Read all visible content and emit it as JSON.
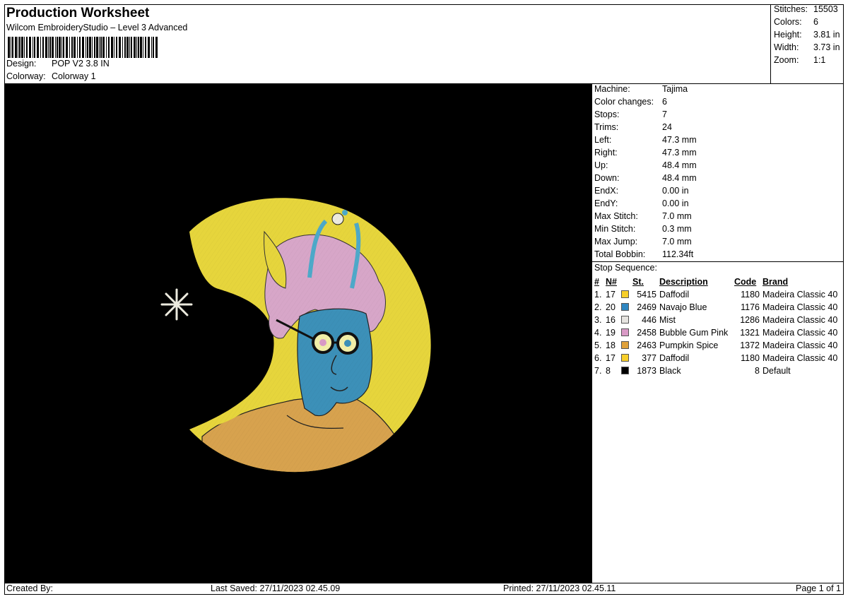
{
  "header": {
    "title": "Production Worksheet",
    "subtitle": "Wilcom EmbroideryStudio – Level 3 Advanced",
    "design_label": "Design:",
    "design_value": "POP V2 3.8 IN",
    "colorway_label": "Colorway:",
    "colorway_value": "Colorway 1"
  },
  "stats": [
    {
      "label": "Stitches:",
      "value": "15503"
    },
    {
      "label": "Colors:",
      "value": "6"
    },
    {
      "label": "Height:",
      "value": "3.81 in"
    },
    {
      "label": "Width:",
      "value": "3.73 in"
    },
    {
      "label": "Zoom:",
      "value": "1:1"
    }
  ],
  "machine": [
    {
      "label": "Machine:",
      "value": "Tajima"
    },
    {
      "label": "Color changes:",
      "value": "6"
    },
    {
      "label": "Stops:",
      "value": "7"
    },
    {
      "label": "Trims:",
      "value": "24"
    },
    {
      "label": "Left:",
      "value": "47.3 mm"
    },
    {
      "label": "Right:",
      "value": "47.3 mm"
    },
    {
      "label": "Up:",
      "value": "48.4 mm"
    },
    {
      "label": "Down:",
      "value": "48.4 mm"
    },
    {
      "label": "EndX:",
      "value": "0.00 in"
    },
    {
      "label": "EndY:",
      "value": "0.00 in"
    },
    {
      "label": "Max Stitch:",
      "value": "7.0 mm"
    },
    {
      "label": "Min Stitch:",
      "value": "0.3 mm"
    },
    {
      "label": "Max Jump:",
      "value": "7.0 mm"
    },
    {
      "label": "Total Bobbin:",
      "value": "112.34ft"
    }
  ],
  "stop_sequence": {
    "title": "Stop Sequence:",
    "headers": {
      "num": "#",
      "n": "N#",
      "st": "St.",
      "description": "Description",
      "code": "Code",
      "brand": "Brand"
    },
    "rows": [
      {
        "num": "1.",
        "n": "17",
        "color": "#F7CF2A",
        "st": "5415",
        "description": "Daffodil",
        "code": "1180",
        "brand": "Madeira Classic 40"
      },
      {
        "num": "2.",
        "n": "20",
        "color": "#2E86C1",
        "st": "2469",
        "description": "Navajo Blue",
        "code": "1176",
        "brand": "Madeira Classic 40"
      },
      {
        "num": "3.",
        "n": "16",
        "color": "#E6E4E0",
        "st": "446",
        "description": "Mist",
        "code": "1286",
        "brand": "Madeira Classic 40"
      },
      {
        "num": "4.",
        "n": "19",
        "color": "#D99AC6",
        "st": "2458",
        "description": "Bubble Gum Pink",
        "code": "1321",
        "brand": "Madeira Classic 40"
      },
      {
        "num": "5.",
        "n": "18",
        "color": "#E0A23C",
        "st": "2463",
        "description": "Pumpkin Spice",
        "code": "1372",
        "brand": "Madeira Classic 40"
      },
      {
        "num": "6.",
        "n": "17",
        "color": "#F7CF2A",
        "st": "377",
        "description": "Daffodil",
        "code": "1180",
        "brand": "Madeira Classic 40"
      },
      {
        "num": "7.",
        "n": "8",
        "color": "#000000",
        "st": "1873",
        "description": "Black",
        "code": "8",
        "brand": "Default"
      }
    ]
  },
  "footer": {
    "created_by": "Created By:",
    "last_saved": "Last Saved: 27/11/2023 02.45.09",
    "printed": "Printed: 27/11/2023 02.45.11",
    "page": "Page 1 of 1"
  },
  "colors": {
    "moon": "#E6D53C",
    "skin": "#3C90B8",
    "hair": "#D7A6C8",
    "sweater": "#D7A24E",
    "star": "#EDEBDF"
  }
}
